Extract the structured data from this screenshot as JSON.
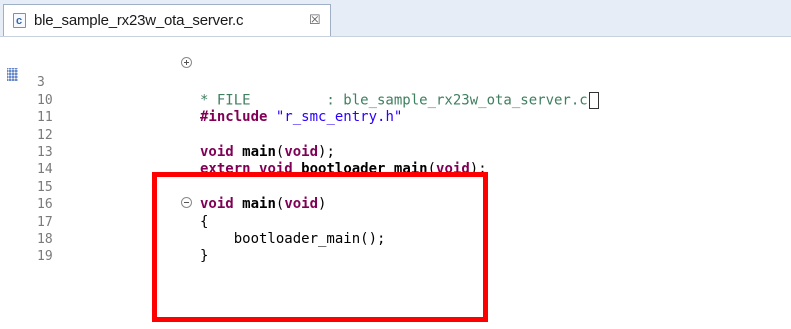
{
  "tab": {
    "file_icon_letter": "c",
    "filename": "ble_sample_rx23w_ota_server.c",
    "close_glyph": "☒"
  },
  "editor": {
    "lines": [
      {
        "num": "3",
        "text": "* FILE         : ble_sample_rx23w_ota_server.c"
      },
      {
        "num": "10",
        "text": "#include \"r_smc_entry.h\""
      },
      {
        "num": "11",
        "text": ""
      },
      {
        "num": "12",
        "text": "void main(void);"
      },
      {
        "num": "13",
        "text": "extern void bootloader_main(void);"
      },
      {
        "num": "14",
        "text": ""
      },
      {
        "num": "15",
        "text": "void main(void)"
      },
      {
        "num": "16",
        "text": "{"
      },
      {
        "num": "17",
        "text": "    bootloader_main();"
      },
      {
        "num": "18",
        "text": "}"
      },
      {
        "num": "19",
        "text": ""
      }
    ]
  },
  "colors": {
    "highlight_box": "#ff0000",
    "keyword": "#7f0055",
    "string": "#2a00ff",
    "comment": "#3f7f5f"
  }
}
